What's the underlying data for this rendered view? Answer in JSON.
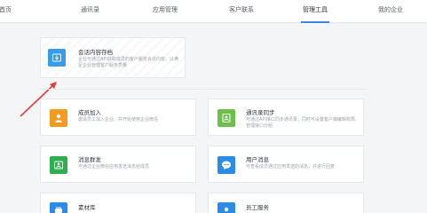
{
  "nav": {
    "tabs": [
      {
        "label": "首页"
      },
      {
        "label": "通讯录"
      },
      {
        "label": "应用管理"
      },
      {
        "label": "客户联系"
      },
      {
        "label": "管理工具",
        "active": true
      },
      {
        "label": "我的企业"
      }
    ]
  },
  "featured": {
    "title": "会话内容存档",
    "desc": "企业可通过API获取成员的客户服务会话内容，以满足企业管理客户服务质量"
  },
  "tools": [
    {
      "title": "成员加入",
      "desc": "邀请员工加入企业，并开始使用企业微信",
      "icon": "person-add-icon",
      "color": "#f39a1f"
    },
    {
      "title": "通讯录同步",
      "desc": "可通过API接口同步通讯录，同时可设置客户端编辑权限、管理接口分组",
      "icon": "contacts-sync-icon",
      "color": "#6cc04a"
    },
    {
      "title": "消息群发",
      "desc": "可通过企业微信应用发送消息给成员",
      "icon": "broadcast-icon",
      "color": "#2fae4f"
    },
    {
      "title": "用户消息",
      "desc": "可查看成员通过应用发送的消息，并进行回复",
      "icon": "chat-bubble-icon",
      "color": "#2a8ce8"
    },
    {
      "title": "素材库",
      "desc": "",
      "icon": "materials-icon",
      "color": "#2a8ce8"
    },
    {
      "title": "员工服务",
      "desc": "",
      "icon": "staff-service-icon",
      "color": "#2a8ce8"
    }
  ],
  "colors": {
    "accent": "#3a86e0",
    "arrow": "#e53935"
  }
}
